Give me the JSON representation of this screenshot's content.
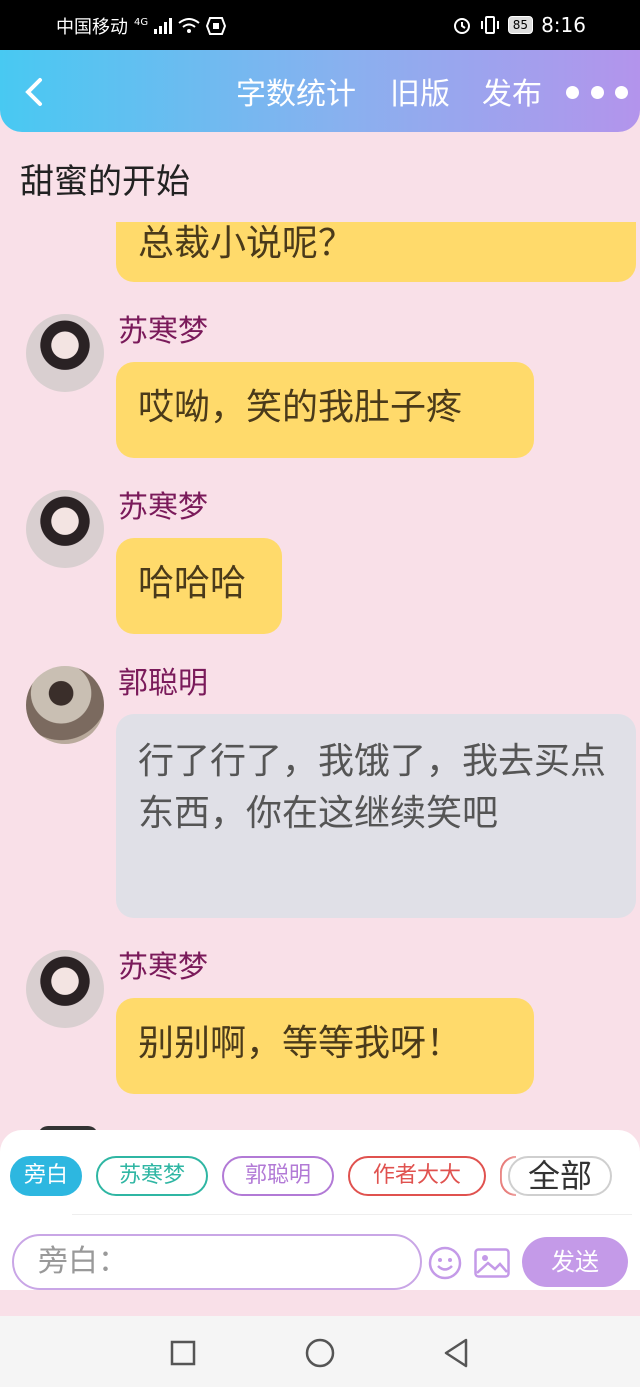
{
  "status": {
    "carrier": "中国移动",
    "network": "4G",
    "battery": "85",
    "time": "8:16"
  },
  "topbar": {
    "word_count": "字数统计",
    "old_version": "旧版",
    "publish": "发布"
  },
  "story_title": "甜蜜的开始",
  "messages": [
    {
      "text": "总裁小说呢？",
      "style": "yellow"
    },
    {
      "name": "苏寒梦",
      "text": "哎呦，笑的我肚子疼",
      "style": "yellow",
      "avatar": "female"
    },
    {
      "name": "苏寒梦",
      "text": "哈哈哈",
      "style": "yellow",
      "avatar": "female"
    },
    {
      "name": "郭聪明",
      "text": "行了行了，我饿了，我去买点东西，你在这继续笑吧",
      "style": "grey",
      "avatar": "male"
    },
    {
      "name": "苏寒梦",
      "text": "别别啊，等等我呀！",
      "style": "yellow",
      "avatar": "female"
    }
  ],
  "chips": [
    {
      "label": "旁白",
      "color": "#2db7e0",
      "active": true
    },
    {
      "label": "苏寒梦",
      "color": "#2fb6a3"
    },
    {
      "label": "郭聪明",
      "color": "#b27ad6"
    },
    {
      "label": "作者大大",
      "color": "#e0524f"
    },
    {
      "label": "全部",
      "color": "#bbbbbb"
    }
  ],
  "input": {
    "placeholder": "旁白："
  },
  "send_label": "发送"
}
